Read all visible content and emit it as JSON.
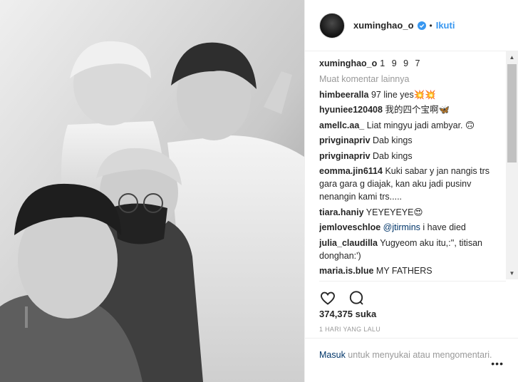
{
  "post": {
    "username": "xuminghao_o",
    "follow_label": "Ikuti",
    "dot": "•",
    "caption_user": "xuminghao_o",
    "caption_text": "1 9 9 7",
    "load_more": "Muat komentar lainnya",
    "comments": [
      {
        "user": "himbeeralla",
        "text": "97 line yes💥💥"
      },
      {
        "user": "hyuniee120408",
        "text": "我的四个宝啊🦋"
      },
      {
        "user": "amellc.aa_",
        "text": "Liat mingyu jadi ambyar. 🙃"
      },
      {
        "user": "privginapriv",
        "text": "Dab kings"
      },
      {
        "user": "privginapriv",
        "text": "Dab kings"
      },
      {
        "user": "eomma.jin6114",
        "text": "Kuki sabar y jan nangis trs gara gara g diajak, kan aku jadi pusinv nenangin kami trs....."
      },
      {
        "user": "tiara.haniy",
        "text": "YEYEYEYE😍"
      },
      {
        "user": "jemloveschloe",
        "mention": "@jtirmins",
        "text": " i have died"
      },
      {
        "user": "julia_claudilla",
        "text": "Yugyeom aku itu,:'', titisan donghan:')"
      },
      {
        "user": "maria.is.blue",
        "text": "MY FATHERS"
      }
    ],
    "likes": "374,375 suka",
    "time": "1 HARI YANG LALU",
    "login_link": "Masuk",
    "login_text": " untuk menyukai atau mengomentari.",
    "more_label": "•••"
  },
  "icons": {
    "avatar": "profile-avatar",
    "verified": "verified-badge-icon",
    "like": "heart-icon",
    "comment": "comment-bubble-icon",
    "more": "more-options-icon"
  },
  "colors": {
    "link": "#3897f0",
    "muted": "#999999",
    "mention": "#003569"
  }
}
